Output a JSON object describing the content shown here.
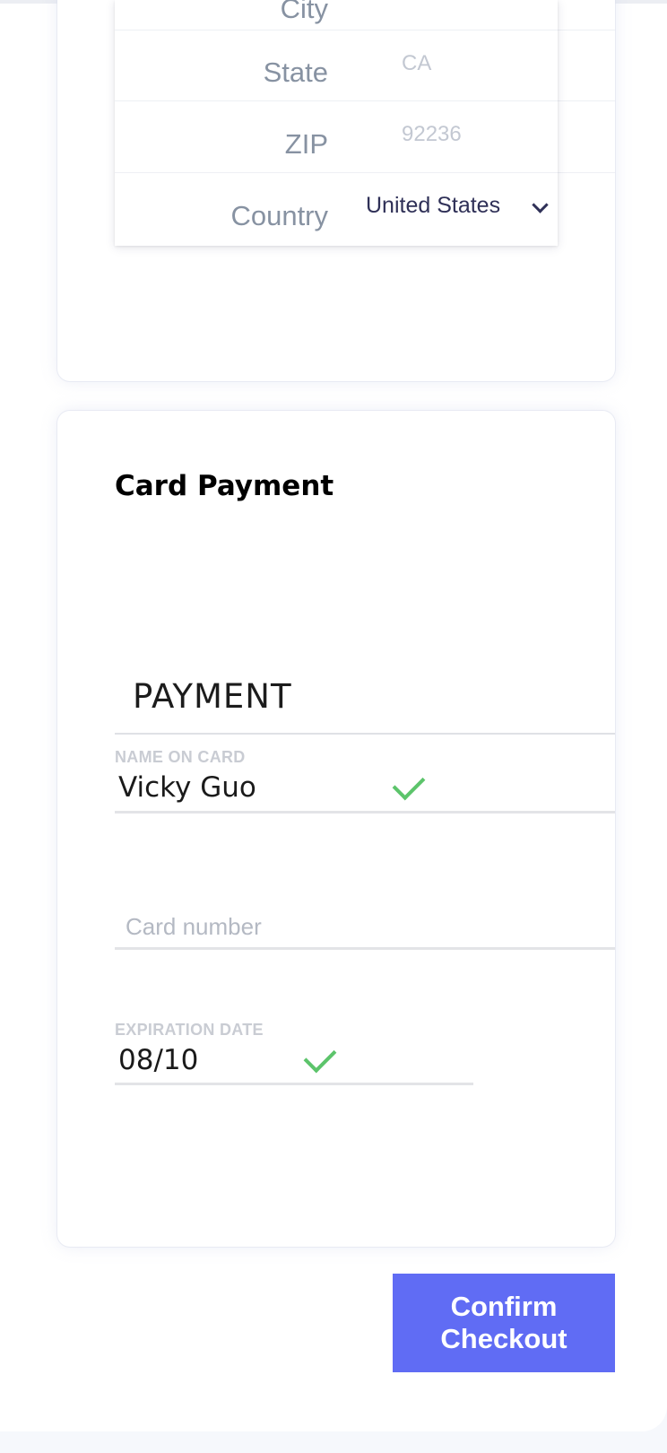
{
  "address": {
    "city_label": "City",
    "state_label": "State",
    "state_value": "CA",
    "zip_label": "ZIP",
    "zip_value": "92236",
    "country_label": "Country",
    "country_value": "United States",
    "country_icon": "chevron-down-icon"
  },
  "payment": {
    "card_title": "Card Payment",
    "section_heading": "PAYMENT",
    "name_label": "NAME ON CARD",
    "name_value": "Vicky Guo",
    "card_number_placeholder": "Card number",
    "expiration_label": "EXPIRATION DATE",
    "expiration_value": "08/10",
    "valid_icon": "checkmark-icon",
    "valid_color": "#5cc46b"
  },
  "actions": {
    "confirm_label": "Confirm Checkout",
    "confirm_color": "#606cf4"
  }
}
